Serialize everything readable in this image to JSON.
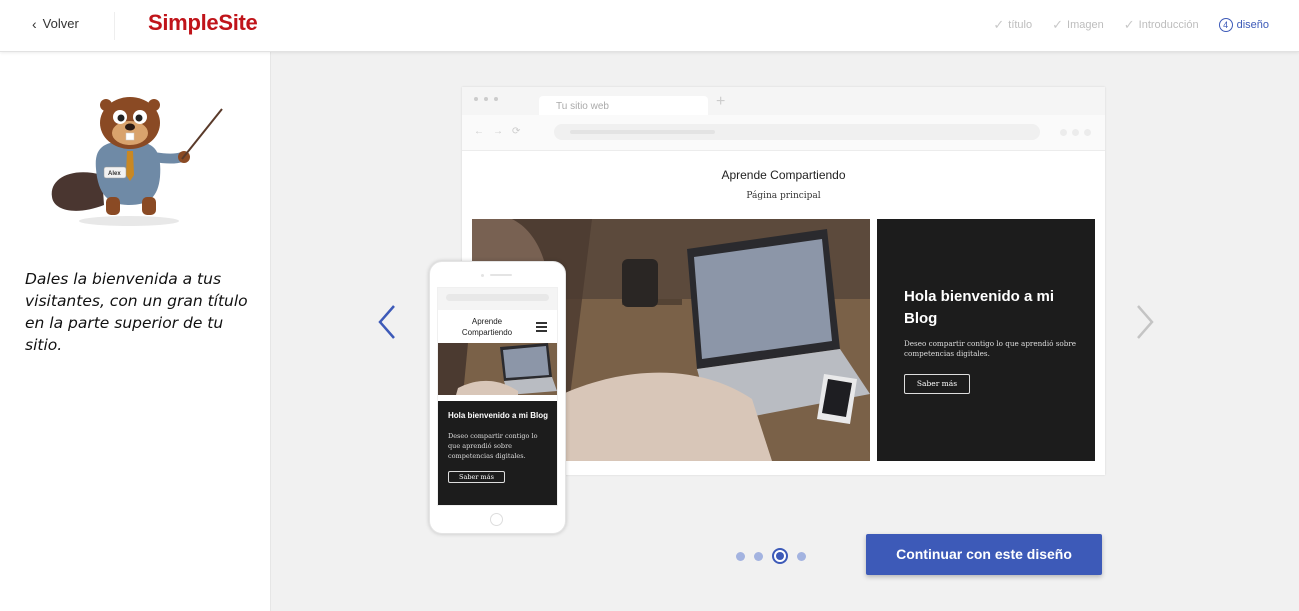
{
  "header": {
    "back_label": "Volver",
    "logo_text": "SimpleSite",
    "steps": [
      {
        "label": "título",
        "state": "done"
      },
      {
        "label": "Imagen",
        "state": "done"
      },
      {
        "label": "Introducción",
        "state": "done"
      },
      {
        "label": "diseño",
        "number": "4",
        "state": "active"
      }
    ]
  },
  "sidebar": {
    "mascot_badge": "Alex",
    "message": "Dales la bienvenida a tus visitantes, con un gran título en la parte superior de tu sitio."
  },
  "preview": {
    "browser_tab": "Tu sitio web",
    "site_title": "Aprende Compartiendo",
    "site_subtitle": "Página principal",
    "hero_heading": "Hola bienvenido a mi Blog",
    "hero_text": "Deseo compartir contigo lo que aprendió sobre competencias digitales.",
    "hero_button": "Saber más",
    "mobile_title": "Aprende Compartiendo",
    "mobile_heading": "Hola bienvenido a mi Blog",
    "mobile_text": "Deseo compartir contigo lo que aprendió sobre competencias digitales.",
    "mobile_button": "Saber más"
  },
  "pager": {
    "total": 4,
    "active_index": 2
  },
  "continue_label": "Continuar con este diseño",
  "colors": {
    "accent": "#3d5ab8",
    "logo": "#c0141a",
    "dark_panel": "#1c1c1c"
  }
}
